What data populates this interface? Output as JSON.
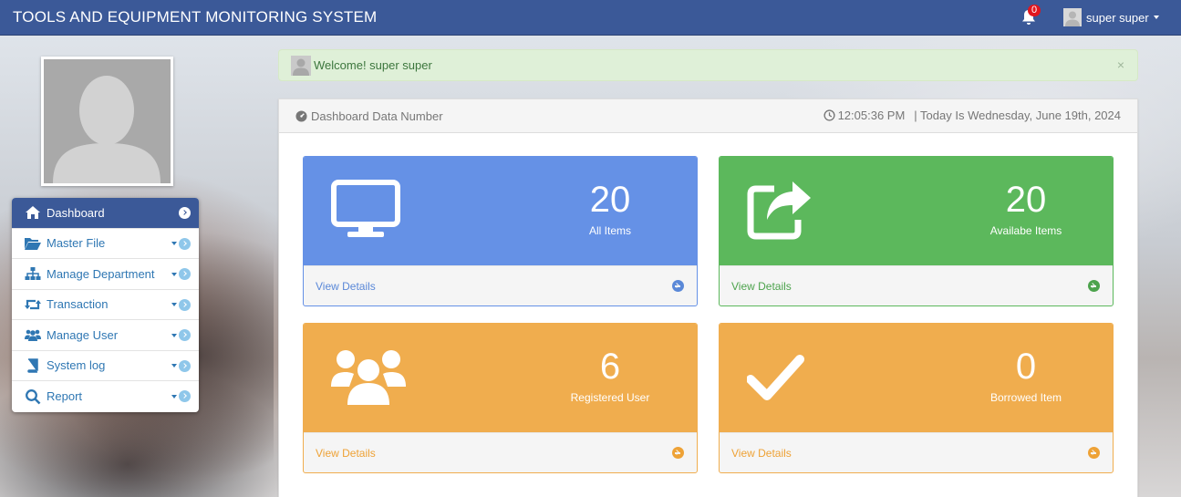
{
  "app": {
    "title": "TOOLS AND EQUIPMENT MONITORING SYSTEM"
  },
  "navbar": {
    "notification_count": "0",
    "user_name": "super super"
  },
  "alert": {
    "message": "Welcome! super super",
    "close": "×"
  },
  "sidebar": {
    "items": [
      {
        "label": "Dashboard",
        "icon": "home-icon"
      },
      {
        "label": "Master File",
        "icon": "folder-open-icon"
      },
      {
        "label": "Manage Department",
        "icon": "sitemap-icon"
      },
      {
        "label": "Transaction",
        "icon": "retweet-icon"
      },
      {
        "label": "Manage User",
        "icon": "users-icon"
      },
      {
        "label": "System log",
        "icon": "book-icon"
      },
      {
        "label": "Report",
        "icon": "search-icon"
      }
    ]
  },
  "panel": {
    "heading": "Dashboard Data Number",
    "time": "12:05:36 PM",
    "date": "| Today Is Wednesday, June 19th, 2024"
  },
  "cards": [
    {
      "value": "20",
      "label": "All Items",
      "link": "View Details",
      "color": "#6591e6",
      "icon": "desktop-icon"
    },
    {
      "value": "20",
      "label": "Availabe Items",
      "link": "View Details",
      "color": "#5cb85c",
      "icon": "share-square-icon"
    },
    {
      "value": "6",
      "label": "Registered User",
      "link": "View Details",
      "color": "#f0ad4e",
      "icon": "users-icon"
    },
    {
      "value": "0",
      "label": "Borrowed Item",
      "link": "View Details",
      "color": "#f0ad4e",
      "icon": "check-icon"
    }
  ]
}
